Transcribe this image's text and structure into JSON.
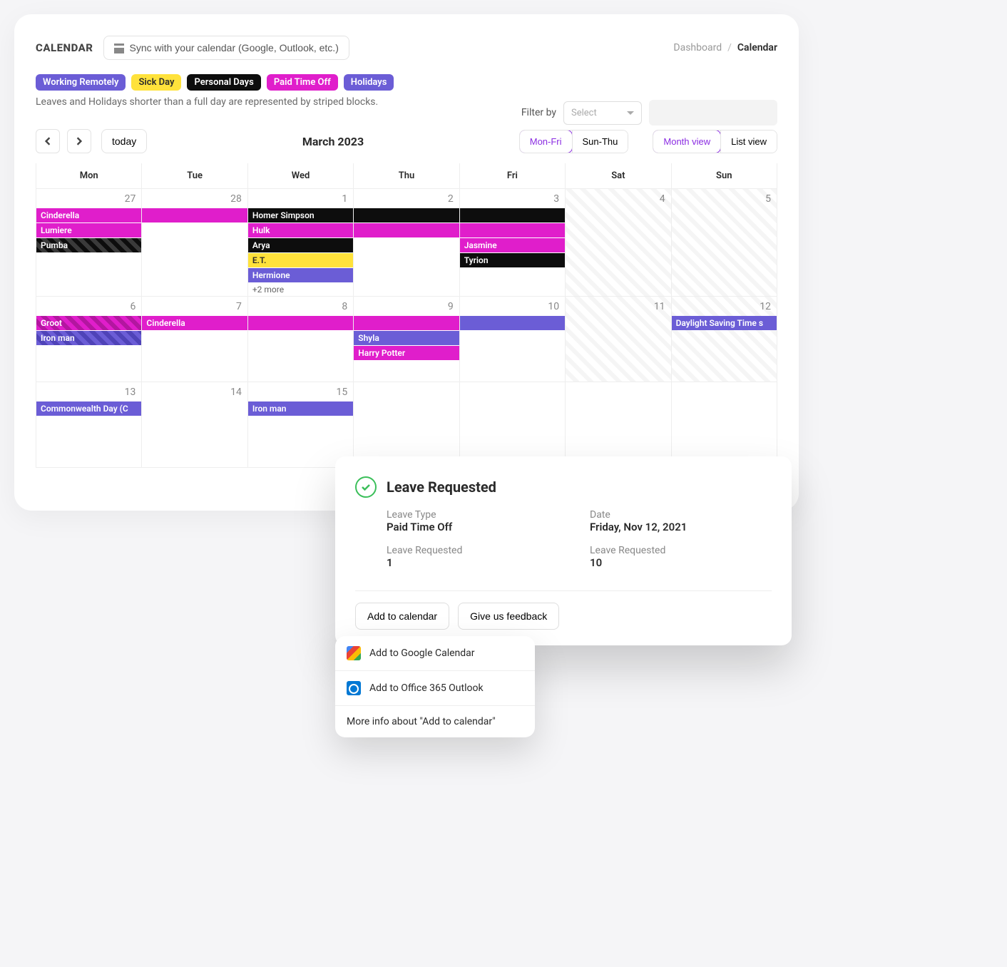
{
  "header": {
    "title": "CALENDAR",
    "sync_label": "Sync with your calendar (Google, Outlook, etc.)",
    "breadcrumb_dashboard": "Dashboard",
    "breadcrumb_current": "Calendar"
  },
  "legend": {
    "working_remotely": "Working Remotely",
    "sick_day": "Sick Day",
    "personal_days": "Personal Days",
    "paid_time_off": "Paid Time Off",
    "holidays": "Holidays"
  },
  "caption": "Leaves and Holidays shorter than a full day are represented by striped blocks.",
  "filter": {
    "label": "Filter by",
    "placeholder": "Select"
  },
  "nav": {
    "today": "today",
    "month_title": "March 2023",
    "mon_fri": "Mon-Fri",
    "sun_thu": "Sun-Thu",
    "month_view": "Month view",
    "list_view": "List view"
  },
  "days_of_week": [
    "Mon",
    "Tue",
    "Wed",
    "Thu",
    "Fri",
    "Sat",
    "Sun"
  ],
  "grid": [
    [
      {
        "d": "27",
        "events": [
          {
            "t": "Cinderella",
            "c": "pink"
          },
          {
            "t": "Lumiere",
            "c": "pink"
          },
          {
            "t": "Pumba",
            "c": "stripe-black"
          }
        ]
      },
      {
        "d": "28",
        "events": [
          {
            "t": "",
            "c": "pink"
          }
        ]
      },
      {
        "d": "1",
        "events": [
          {
            "t": "Homer Simpson",
            "c": "black"
          },
          {
            "t": "Hulk",
            "c": "pink"
          },
          {
            "t": "Arya",
            "c": "black"
          },
          {
            "t": "E.T.",
            "c": "yellow"
          },
          {
            "t": "Hermione",
            "c": "purple"
          }
        ],
        "more": "+2 more"
      },
      {
        "d": "2",
        "events": [
          {
            "t": "",
            "c": "black"
          },
          {
            "t": "",
            "c": "pink"
          }
        ]
      },
      {
        "d": "3",
        "events": [
          {
            "t": "",
            "c": "black"
          },
          {
            "t": "",
            "c": "pink"
          },
          {
            "t": "Jasmine",
            "c": "pink"
          },
          {
            "t": "Tyrion",
            "c": "black"
          }
        ]
      },
      {
        "d": "4",
        "weekend": true,
        "events": []
      },
      {
        "d": "5",
        "weekend": true,
        "events": []
      }
    ],
    [
      {
        "d": "6",
        "events": [
          {
            "t": "Groot",
            "c": "stripe-pink"
          },
          {
            "t": "Iron man",
            "c": "stripe-purple"
          }
        ]
      },
      {
        "d": "7",
        "events": [
          {
            "t": "Cinderella",
            "c": "pink"
          }
        ]
      },
      {
        "d": "8",
        "events": [
          {
            "t": "",
            "c": "pink"
          }
        ]
      },
      {
        "d": "9",
        "events": [
          {
            "t": "",
            "c": "pink"
          },
          {
            "t": "Shyla",
            "c": "purple"
          },
          {
            "t": "Harry Potter",
            "c": "pink"
          }
        ]
      },
      {
        "d": "10",
        "events": [
          {
            "t": "",
            "c": "purple"
          }
        ]
      },
      {
        "d": "11",
        "weekend": true,
        "events": []
      },
      {
        "d": "12",
        "weekend": true,
        "events": [
          {
            "t": "Daylight Saving Time s",
            "c": "purple"
          }
        ]
      }
    ],
    [
      {
        "d": "13",
        "events": [
          {
            "t": "Commonwealth Day (C",
            "c": "purple"
          }
        ]
      },
      {
        "d": "14",
        "events": []
      },
      {
        "d": "15",
        "events": [
          {
            "t": "Iron man",
            "c": "purple"
          }
        ]
      },
      {
        "d": "",
        "events": []
      },
      {
        "d": "",
        "events": []
      },
      {
        "d": "",
        "events": []
      },
      {
        "d": "",
        "events": []
      }
    ]
  ],
  "modal": {
    "title": "Leave Requested",
    "leave_type_label": "Leave Type",
    "leave_type_value": "Paid Time Off",
    "date_label": "Date",
    "date_value": "Friday, Nov 12, 2021",
    "req1_label": "Leave Requested",
    "req1_value": "1",
    "req2_label": "Leave Requested",
    "req2_value": "10",
    "add_to_calendar": "Add to calendar",
    "give_feedback": "Give us feedback"
  },
  "dropdown": {
    "google": "Add to Google Calendar",
    "outlook": "Add to Office 365 Outlook",
    "more": "More info about \"Add to calendar\""
  }
}
